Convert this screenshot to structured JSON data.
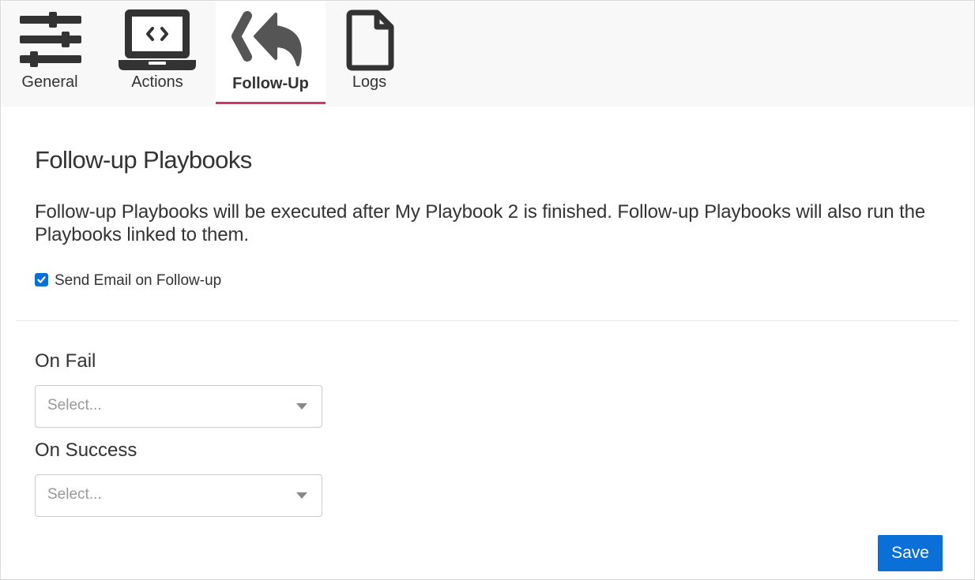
{
  "tabs": [
    {
      "label": "General",
      "icon": "sliders-icon"
    },
    {
      "label": "Actions",
      "icon": "laptop-code-icon"
    },
    {
      "label": "Follow-Up",
      "icon": "reply-all-icon",
      "active": true
    },
    {
      "label": "Logs",
      "icon": "file-icon"
    }
  ],
  "content": {
    "title": "Follow-up Playbooks",
    "description": "Follow-up Playbooks will be executed after My Playbook 2 is finished. Follow-up Playbooks will also run the Playbooks linked to them.",
    "send_email": {
      "label": "Send Email on Follow-up",
      "checked": true
    },
    "on_fail": {
      "label": "On Fail",
      "placeholder": "Select..."
    },
    "on_success": {
      "label": "On Success",
      "placeholder": "Select..."
    },
    "save_label": "Save"
  },
  "colors": {
    "accent": "#0b6fd8",
    "active_tab_underline": "#d6336c",
    "icon": "#333333"
  }
}
